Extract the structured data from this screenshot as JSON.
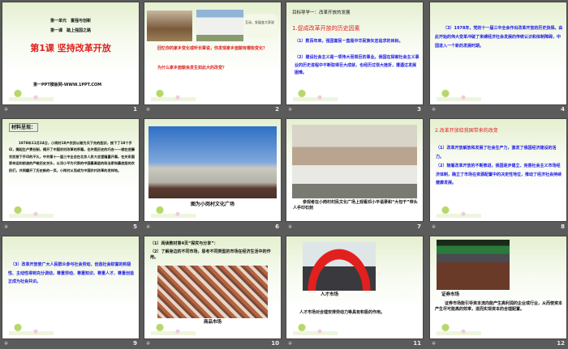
{
  "slides": [
    {
      "number": "1",
      "unit": "第一单元　富强与创新",
      "lesson": "第一课　踏上强国之路",
      "title": "第1课 坚持改革开放",
      "footer": "第一PPT模板网-WWW.1PPT.COM"
    },
    {
      "number": "2",
      "sign": "互动、发展变大家说",
      "q1": "回忆你的家乡变化或听长辈说，你发现家乡面貌有哪些变化？",
      "q2": "为什么家乡面貌会发生如此大的改变？"
    },
    {
      "number": "3",
      "heading": "目标导学一：改革开放的发展",
      "sub": "1.促成改革开放的历史因素",
      "p1": "（1）数百年来，强国富民一直是中华民族矢志追求的目标。",
      "p2": "（2）建设社会主义是一项伟大而艰巨的事业。我国在探索社会主义事业的历史进程中不断取得巨大成就，也经历过很大挫折，遭遇过发展困难。"
    },
    {
      "number": "4",
      "p1": "（3）1978年，党的十一届三中全会作出改革开放的历史抉择。由此开始的伟大变革冲破了束缚经济社会发展的传统认识和体制障碍，中国进入一个新的发展时期。"
    },
    {
      "number": "5",
      "label": "材料呈现：",
      "p1": "1978年11月24日，小岗村18户农民以敢为天下先的胆识，按下了18个手印，搞起生产责任制，揭开了中国农村改革的序幕。也许是历史的巧合——就在逆藤农民按下手印的不久，中共第十一届三中全会在北京人民大会堂隆重开幕。在关系国家命运和前途的严峻历史关头，以邓小平为代表的中国最高层的政治家和最底层的农民们，共同翻开了历史新的一页。小岗村从而成为中国农村改革的发祥地。"
    },
    {
      "number": "6",
      "caption": "图为小岗村文化广场"
    },
    {
      "number": "7",
      "caption": "参观者在小岗村村民文化广场上观看邓小平语录和“大包干”带头人手印石刻"
    },
    {
      "number": "8",
      "sub": "2.改革开放给我国带来的改变",
      "p1": "（1）改革开放解放和发展了社会生产力，激发了我国经济建设的活力。",
      "p2": "（2）随着改革开放的不断推进，我国逐步建立、完善社会主义市场经济体制，确立了市场在资源配置中的决定性地位，推动了经济社会持续健康发展。"
    },
    {
      "number": "9",
      "p1": "（3）改革开放使广大人民群众参与社会劳动、创造社会财富的积极性、主动性得到充分调动，尊重劳动、尊重知识、尊重人才、尊重创造正成为社会共识。"
    },
    {
      "number": "10",
      "p1": "（1）阅读教材第4页“探究与分享”：",
      "p2": "（2）了解身边的不同市场，思考不同类型的市场在经济生活中的作用。",
      "caption": "商品市场"
    },
    {
      "number": "11",
      "caption": "人才市场",
      "p1": "人才市场对合理安排劳动力等具有积极的作用。"
    },
    {
      "number": "12",
      "caption": "证券市场",
      "p1": "证券市场能引导资本流向能产生高利润的企业或行业，从而使资本产生尽可能高的效率，进而实现资本的合理配置。"
    }
  ]
}
